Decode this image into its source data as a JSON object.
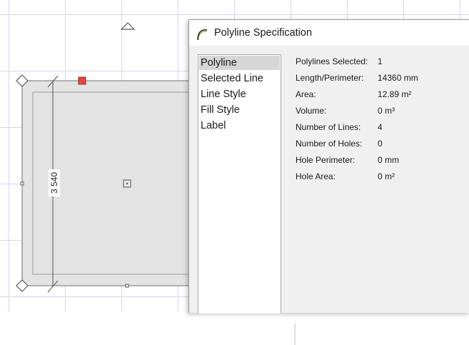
{
  "dimension": {
    "text": "3 540"
  },
  "dialog": {
    "title": "Polyline Specification",
    "icon": "polyline-arc-icon",
    "nav_items": [
      {
        "label": "Polyline",
        "selected": true
      },
      {
        "label": "Selected Line",
        "selected": false
      },
      {
        "label": "Line Style",
        "selected": false
      },
      {
        "label": "Fill Style",
        "selected": false
      },
      {
        "label": "Label",
        "selected": false
      }
    ],
    "properties": [
      {
        "label": "Polylines Selected:",
        "value": "1"
      },
      {
        "label": "Length/Perimeter:",
        "value": "14360 mm"
      },
      {
        "label": "Area:",
        "value": "12.89 m²"
      },
      {
        "label": "Volume:",
        "value": "0 m³"
      },
      {
        "label": "Number of Lines:",
        "value": "4"
      },
      {
        "label": "Number of Holes:",
        "value": "0"
      },
      {
        "label": "Hole Perimeter:",
        "value": "0 mm"
      },
      {
        "label": "Hole Area:",
        "value": "0 m²"
      }
    ]
  },
  "colors": {
    "grid": "#d9d4ec",
    "polyline_fill": "#e3e3e3",
    "handle_active": "#e0463f",
    "dialog_bg": "#f0f0f0"
  }
}
